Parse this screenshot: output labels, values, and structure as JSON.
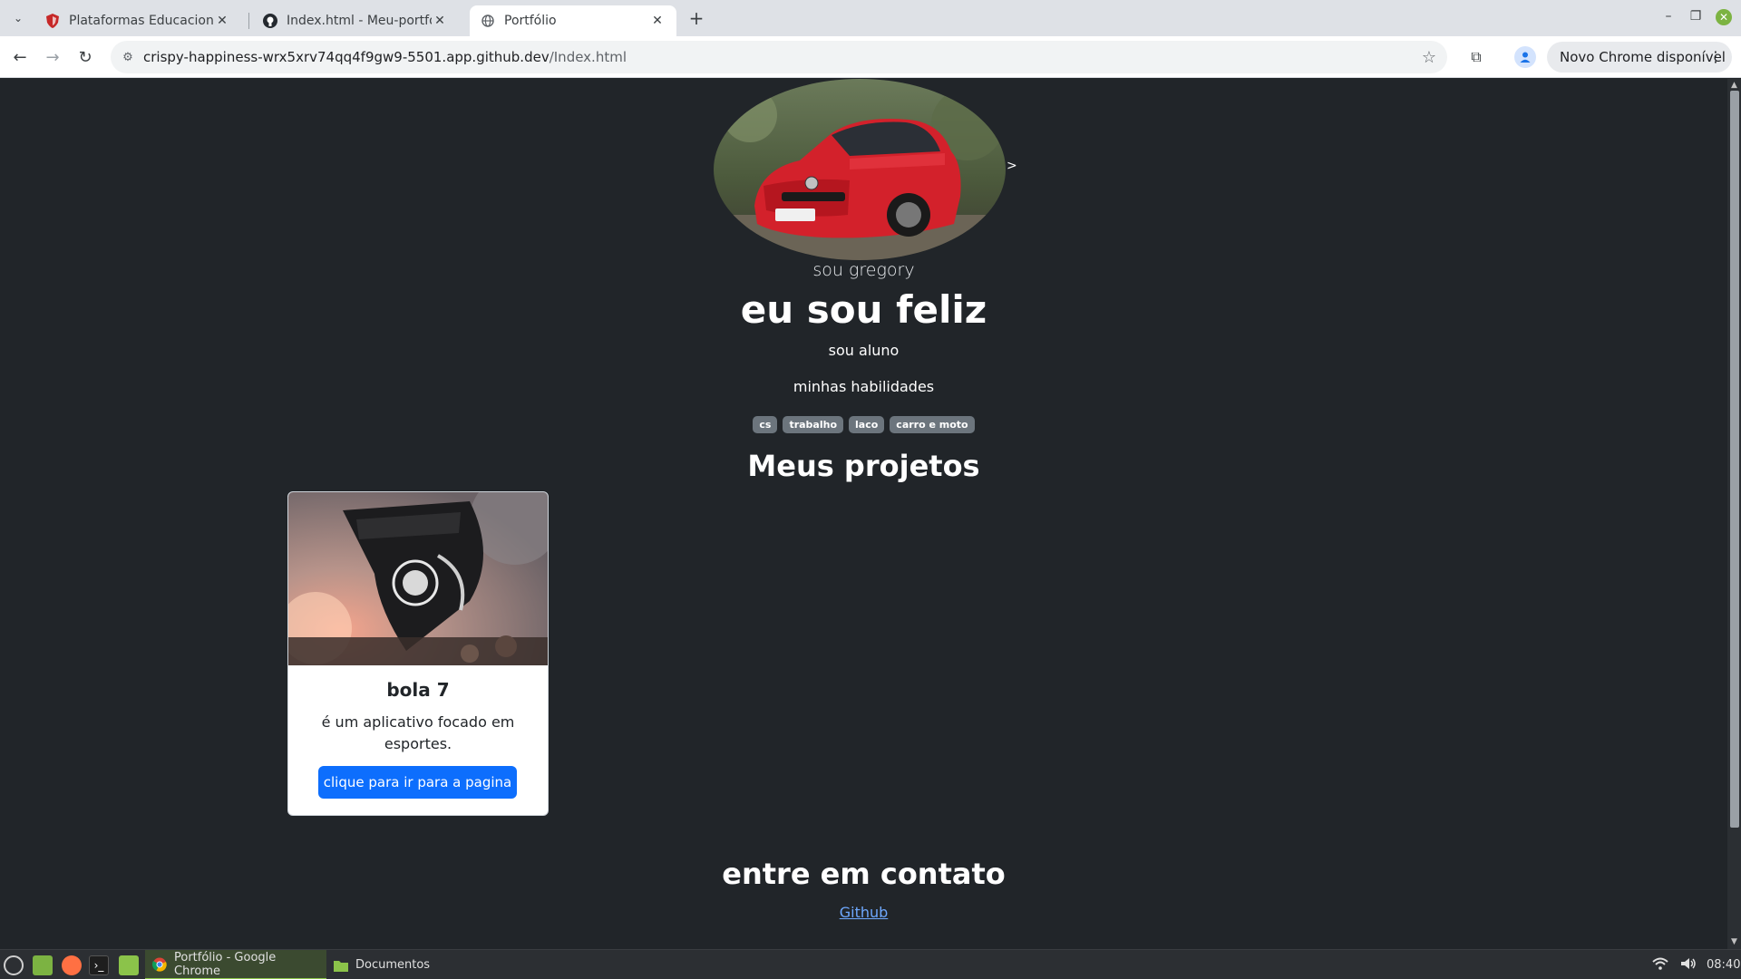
{
  "browser": {
    "tabs": [
      {
        "title": "Plataformas Educacionais",
        "favicon": "shield-favicon",
        "active": false
      },
      {
        "title": "Index.html - Meu-portfolio-",
        "favicon": "github-favicon",
        "active": false
      },
      {
        "title": "Portfólio",
        "favicon": "globe-favicon",
        "active": true
      }
    ],
    "address": {
      "host": "crispy-happiness-wrx5xrv74qq4f9gw9-5501.app.github.dev",
      "path": "/Index.html"
    },
    "update_chip": "Novo Chrome disponível",
    "colors": {
      "tabbar": "#dee1e6",
      "toolbar": "#ffffff",
      "omnibox": "#f1f3f4"
    }
  },
  "page": {
    "hero": {
      "stray_text": ">",
      "intro": "sou gregory",
      "headline": "eu sou feliz",
      "role": "sou aluno",
      "skills_label": "minhas habilidades",
      "skills": [
        "cs",
        "trabalho",
        "laco",
        "carro e moto"
      ]
    },
    "projects": {
      "title": "Meus projetos",
      "cards": [
        {
          "title": "bola 7",
          "text": "é um aplicativo focado em esportes.",
          "button": "clique para ir para a pagina"
        }
      ]
    },
    "contact": {
      "title": "entre em contato",
      "link": "Github"
    },
    "colors": {
      "background": "#212529",
      "primary": "#0d6efd",
      "badge": "#6c757d",
      "link": "#6ea8fe"
    }
  },
  "taskbar": {
    "tasks": [
      {
        "label": "Portfólio - Google Chrome",
        "icon": "chrome-icon",
        "active": true
      },
      {
        "label": "Documentos",
        "icon": "folder-icon",
        "active": false
      }
    ],
    "clock": "08:40"
  }
}
